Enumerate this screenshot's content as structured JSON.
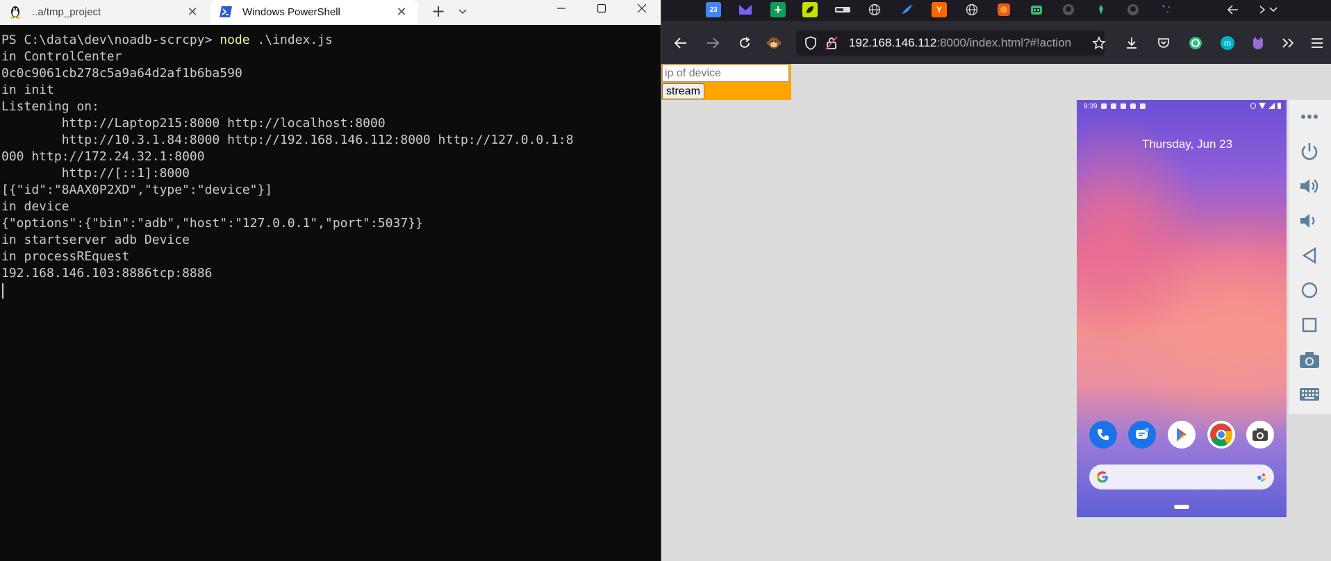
{
  "terminal": {
    "tabs": [
      {
        "title": "..a/tmp_project",
        "icon": "linux-penguin-icon"
      },
      {
        "title": "Windows PowerShell",
        "icon": "powershell-icon"
      }
    ],
    "new_tab": "+",
    "prompt": "PS C:\\data\\dev\\noadb-scrcpy> ",
    "command_name": "node",
    "command_args": " .\\index.js",
    "lines": [
      "in ControlCenter",
      "0c0c9061cb278c5a9a64d2af1b6ba590",
      "in init",
      "Listening on:",
      "        http://Laptop215:8000 http://localhost:8000",
      "        http://10.3.1.84:8000 http://192.168.146.112:8000 http://127.0.0.1:8",
      "000 http://172.24.32.1:8000",
      "        http://[::1]:8000",
      "[{\"id\":\"8AAX0P2XD\",\"type\":\"device\"}]",
      "in device",
      "{\"options\":{\"bin\":\"adb\",\"host\":\"127.0.0.1\",\"port\":5037}}",
      "in startserver adb Device",
      "in processREquest",
      "192.168.146.103:8886tcp:8886"
    ]
  },
  "browser": {
    "url_host": "192.168.146.112",
    "url_rest": ":8000/index.html?#!action",
    "bookmarks": [
      "calendar-icon",
      "mail-icon",
      "plus-icon",
      "leaf-icon",
      "badge-icon",
      "globe-icon",
      "bird-icon",
      "y-icon",
      "globe-icon",
      "pinwheel-icon",
      "robot-icon",
      "github-icon",
      "alien-icon",
      "github-icon",
      "sparkle-icon",
      "back-icon",
      "more-icon"
    ],
    "page": {
      "ip_placeholder": "ip of device",
      "stream_label": "stream"
    },
    "phone": {
      "time": "9:39",
      "date": "Thursday, Jun 23",
      "dock_apps": [
        "phone-app-icon",
        "messages-app-icon",
        "play-store-icon",
        "chrome-icon",
        "camera-app-icon"
      ]
    },
    "side_controls": [
      "more-icon",
      "power-icon",
      "volume-up-icon",
      "volume-down-icon",
      "back-icon",
      "home-icon",
      "overview-icon",
      "screenshot-icon",
      "keyboard-icon"
    ]
  },
  "colors": {
    "terminal_bg": "#0c0c0c",
    "terminal_fg": "#cccccc",
    "command_color": "#f9f1a5",
    "control_panel_bg": "#ffa500",
    "browser_chrome": "#2b2a33"
  }
}
